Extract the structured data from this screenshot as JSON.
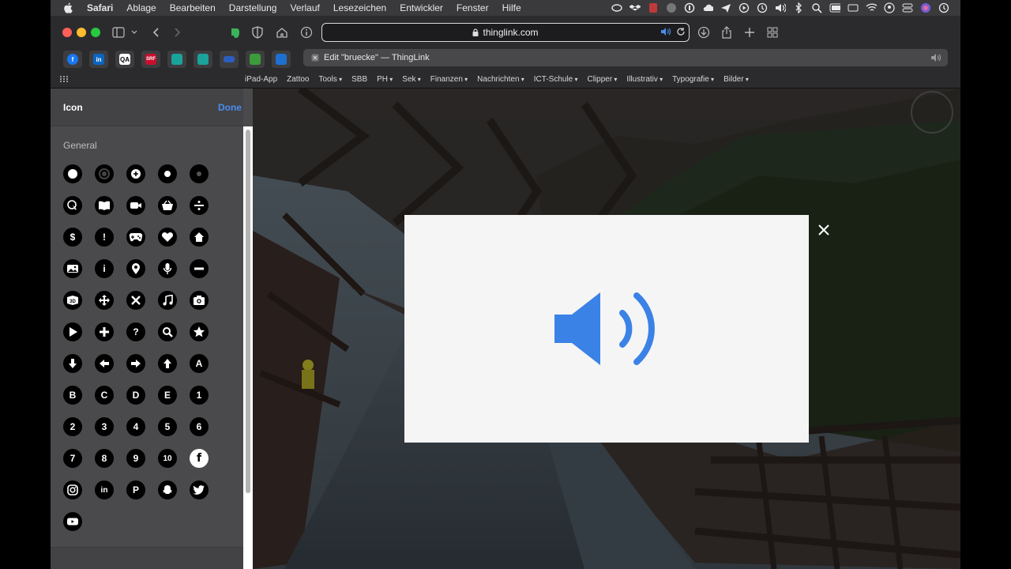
{
  "menubar": {
    "items": [
      "Safari",
      "Ablage",
      "Bearbeiten",
      "Darstellung",
      "Verlauf",
      "Lesezeichen",
      "Entwickler",
      "Fenster",
      "Hilfe"
    ]
  },
  "browser": {
    "url": "thinglink.com",
    "tab_title": "Edit \"bruecke\" — ThingLink",
    "bookmarks": [
      {
        "label": "iPad-App",
        "menu": false
      },
      {
        "label": "Zattoo",
        "menu": false
      },
      {
        "label": "Tools",
        "menu": true
      },
      {
        "label": "SBB",
        "menu": false
      },
      {
        "label": "PH",
        "menu": true
      },
      {
        "label": "Sek",
        "menu": true
      },
      {
        "label": "Finanzen",
        "menu": true
      },
      {
        "label": "Nachrichten",
        "menu": true
      },
      {
        "label": "ICT-Schule",
        "menu": true
      },
      {
        "label": "Clipper",
        "menu": true
      },
      {
        "label": "Illustrativ",
        "menu": true
      },
      {
        "label": "Typografie",
        "menu": true
      },
      {
        "label": "Bilder",
        "menu": true
      }
    ],
    "favorites": [
      {
        "name": "facebook-favicon",
        "text": "f",
        "color": "#1877f2"
      },
      {
        "name": "linkedin-favicon",
        "text": "in",
        "color": "#0a66c2"
      },
      {
        "name": "qa-favicon",
        "text": "QA",
        "color": "#ffffff"
      },
      {
        "name": "srf-favicon",
        "text": "SRF",
        "color": "#c8102e"
      },
      {
        "name": "teal-favicon-1",
        "text": "",
        "color": "#1aa39a"
      },
      {
        "name": "teal-favicon-2",
        "text": "",
        "color": "#1aa39a"
      },
      {
        "name": "blue-favicon",
        "text": "",
        "color": "#2b5fbf"
      },
      {
        "name": "green-favicon",
        "text": "",
        "color": "#3c9b3a"
      },
      {
        "name": "outlook-favicon",
        "text": "",
        "color": "#1f6fd1"
      }
    ]
  },
  "panel": {
    "title": "Icon",
    "done_label": "Done",
    "section": "General",
    "icons": [
      {
        "name": "dot-filled-icon"
      },
      {
        "name": "dot-ring-icon"
      },
      {
        "name": "plus-circle-icon"
      },
      {
        "name": "dot-small-icon"
      },
      {
        "name": "dot-tiny-icon"
      },
      {
        "name": "tap-icon"
      },
      {
        "name": "book-icon"
      },
      {
        "name": "video-icon"
      },
      {
        "name": "basket-icon"
      },
      {
        "name": "divide-icon"
      },
      {
        "name": "dollar-icon",
        "text": "$"
      },
      {
        "name": "exclamation-icon",
        "text": "!"
      },
      {
        "name": "gamepad-icon"
      },
      {
        "name": "heart-icon"
      },
      {
        "name": "home-icon"
      },
      {
        "name": "image-icon"
      },
      {
        "name": "info-icon",
        "text": "i"
      },
      {
        "name": "location-pin-icon"
      },
      {
        "name": "microphone-icon"
      },
      {
        "name": "minus-icon"
      },
      {
        "name": "3d-icon"
      },
      {
        "name": "move-icon"
      },
      {
        "name": "close-icon"
      },
      {
        "name": "music-icon"
      },
      {
        "name": "camera-icon"
      },
      {
        "name": "play-icon"
      },
      {
        "name": "plus-icon"
      },
      {
        "name": "question-icon",
        "text": "?"
      },
      {
        "name": "search-icon"
      },
      {
        "name": "star-icon"
      },
      {
        "name": "arrow-down-icon"
      },
      {
        "name": "arrow-left-icon"
      },
      {
        "name": "arrow-right-icon"
      },
      {
        "name": "arrow-up-icon"
      },
      {
        "name": "letter-a-icon",
        "text": "A"
      },
      {
        "name": "letter-b-icon",
        "text": "B"
      },
      {
        "name": "letter-c-icon",
        "text": "C"
      },
      {
        "name": "letter-d-icon",
        "text": "D"
      },
      {
        "name": "letter-e-icon",
        "text": "E"
      },
      {
        "name": "number-1-icon",
        "text": "1"
      },
      {
        "name": "number-2-icon",
        "text": "2"
      },
      {
        "name": "number-3-icon",
        "text": "3"
      },
      {
        "name": "number-4-icon",
        "text": "4"
      },
      {
        "name": "number-5-icon",
        "text": "5"
      },
      {
        "name": "number-6-icon",
        "text": "6"
      },
      {
        "name": "number-7-icon",
        "text": "7"
      },
      {
        "name": "number-8-icon",
        "text": "8"
      },
      {
        "name": "number-9-icon",
        "text": "9"
      },
      {
        "name": "number-10-icon",
        "text": "10"
      },
      {
        "name": "facebook-icon",
        "text": "f"
      },
      {
        "name": "instagram-icon"
      },
      {
        "name": "linkedin-icon",
        "text": "in"
      },
      {
        "name": "pinterest-icon",
        "text": "P"
      },
      {
        "name": "snapchat-icon"
      },
      {
        "name": "twitter-icon"
      },
      {
        "name": "youtube-icon"
      }
    ]
  },
  "preview": {
    "icon": "speaker-icon",
    "icon_color": "#3b82e6"
  }
}
